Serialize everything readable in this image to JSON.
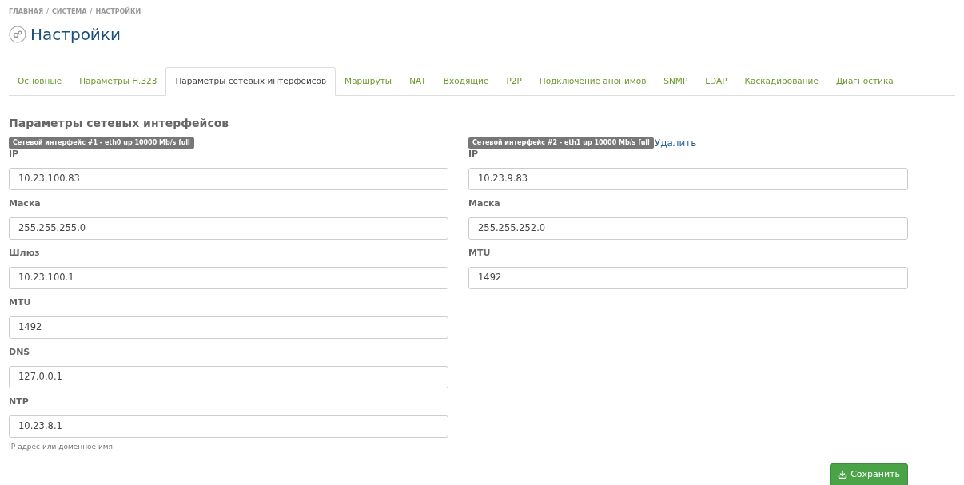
{
  "breadcrumb": [
    "ГЛАВНАЯ",
    "СИСТЕМА",
    "НАСТРОЙКИ"
  ],
  "breadcrumb_separator": "/",
  "page_title": "Настройки",
  "tabs": [
    {
      "label": "Основные",
      "selected": false
    },
    {
      "label": "Параметры H.323",
      "selected": false
    },
    {
      "label": "Параметры сетевых интерфейсов",
      "selected": true
    },
    {
      "label": "Маршруты",
      "selected": false
    },
    {
      "label": "NAT",
      "selected": false
    },
    {
      "label": "Входящие",
      "selected": false
    },
    {
      "label": "P2P",
      "selected": false
    },
    {
      "label": "Подключение анонимов",
      "selected": false
    },
    {
      "label": "SNMP",
      "selected": false
    },
    {
      "label": "LDAP",
      "selected": false
    },
    {
      "label": "Каскадирование",
      "selected": false
    },
    {
      "label": "Диагностика",
      "selected": false
    }
  ],
  "section_title": "Параметры сетевых интерфейсов",
  "interfaces": [
    {
      "badge": "Сетевой интерфейс #1 - eth0 up 10000 Mb/s full",
      "fields": [
        {
          "label": "IP",
          "value": "10.23.100.83"
        },
        {
          "label": "Маска",
          "value": "255.255.255.0"
        },
        {
          "label": "Шлюз",
          "value": "10.23.100.1"
        },
        {
          "label": "MTU",
          "value": "1492"
        },
        {
          "label": "DNS",
          "value": "127.0.0.1"
        },
        {
          "label": "NTP",
          "value": "10.23.8.1",
          "help": "IP-адрес или доменное имя"
        }
      ]
    },
    {
      "badge": "Сетевой интерфейс #2 - eth1 up 10000 Mb/s full",
      "delete_link": "Удалить",
      "fields": [
        {
          "label": "IP",
          "value": "10.23.9.83"
        },
        {
          "label": "Маска",
          "value": "255.255.252.0"
        },
        {
          "label": "MTU",
          "value": "1492"
        }
      ]
    }
  ],
  "save_button": "Сохранить"
}
